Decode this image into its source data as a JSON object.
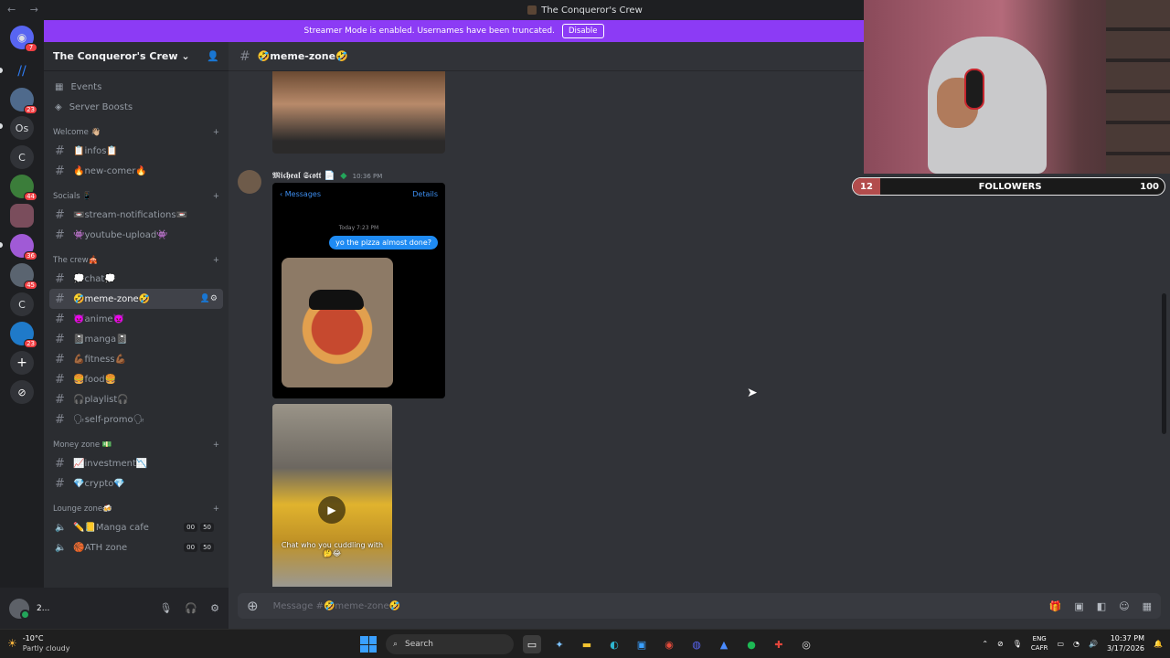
{
  "window": {
    "title": "The Conqueror's Crew"
  },
  "banner": {
    "text": "Streamer Mode is enabled. Usernames have been truncated.",
    "disable_label": "Disable",
    "color": "#8c3bf5"
  },
  "rail": {
    "servers": [
      {
        "label": "",
        "badge": "7",
        "icon": "discord-icon"
      },
      {
        "label": "",
        "badge": "",
        "icon": "nitro-icon"
      },
      {
        "label": "",
        "badge": "23",
        "icon": "server-avatar"
      },
      {
        "label": "Os",
        "badge": ""
      },
      {
        "label": "C",
        "badge": ""
      },
      {
        "label": "",
        "badge": "44",
        "icon": "server-avatar"
      },
      {
        "label": "",
        "badge": "",
        "icon": "server-avatar"
      },
      {
        "label": "",
        "badge": "36",
        "icon": "server-avatar"
      },
      {
        "label": "",
        "badge": "45",
        "icon": "server-avatar"
      },
      {
        "label": "C",
        "badge": ""
      },
      {
        "label": "",
        "badge": "23",
        "icon": "server-avatar"
      }
    ],
    "add_label": "+",
    "discover_label": "⊘"
  },
  "sidebar": {
    "server_name": "The Conqueror's Crew",
    "top_items": [
      {
        "label": "Events"
      },
      {
        "label": "Server Boosts"
      }
    ],
    "categories": [
      {
        "name": "Welcome 👋🏼",
        "channels": [
          {
            "label": "📋infos📋"
          },
          {
            "label": "🔥new-comer🔥"
          }
        ]
      },
      {
        "name": "Socials 📱",
        "channels": [
          {
            "label": "📼stream-notifications📼"
          },
          {
            "label": "👾youtube-upload👾"
          }
        ]
      },
      {
        "name": "The crew🎪",
        "channels": [
          {
            "label": "💭chat💭"
          },
          {
            "label": "🤣meme-zone🤣",
            "active": true
          },
          {
            "label": "👿anime👿"
          },
          {
            "label": "📓manga📓"
          },
          {
            "label": "💪🏾fitness💪🏾"
          },
          {
            "label": "🍔food🍔"
          },
          {
            "label": "🎧playlist🎧"
          },
          {
            "label": "🗣self-promo🗣"
          }
        ]
      },
      {
        "name": "Money zone 💵",
        "channels": [
          {
            "label": "📈investment📉"
          },
          {
            "label": "💎crypto💎"
          }
        ]
      },
      {
        "name": "Lounge zone🍻",
        "channels": [
          {
            "label": "✏️📒Manga cafe",
            "voice": true,
            "counts": [
              "00",
              "50"
            ]
          },
          {
            "label": "🏀ATH zone",
            "voice": true,
            "counts": [
              "00",
              "50"
            ]
          }
        ]
      }
    ]
  },
  "user": {
    "name": "2..."
  },
  "channel": {
    "name": "🤣meme-zone🤣"
  },
  "message": {
    "author": "𝕸𝖎𝖈𝖍𝖊𝖆𝖑 𝕾𝖈𝖔𝖙𝖙 📄",
    "time": "10:36 PM",
    "screenshot": {
      "back": "Messages",
      "details": "Details",
      "today": "Today 7:23 PM",
      "bubble": "yo the pizza almost done?"
    },
    "video_caption": "Chat who you cuddling with🤔😂"
  },
  "composer": {
    "placeholder": "Message #🤣meme-zone🤣"
  },
  "overlay": {
    "followers_label": "FOLLOWERS",
    "followers_current": "12",
    "followers_goal": "100",
    "progress_fraction": 0.12
  },
  "taskbar": {
    "weather_temp": "-10°C",
    "weather_cond": "Partly cloudy",
    "search_placeholder": "Search",
    "lang_top": "ENG",
    "lang_bottom": "CAFR",
    "time": "10:37 PM",
    "date": "3/17/2026"
  }
}
